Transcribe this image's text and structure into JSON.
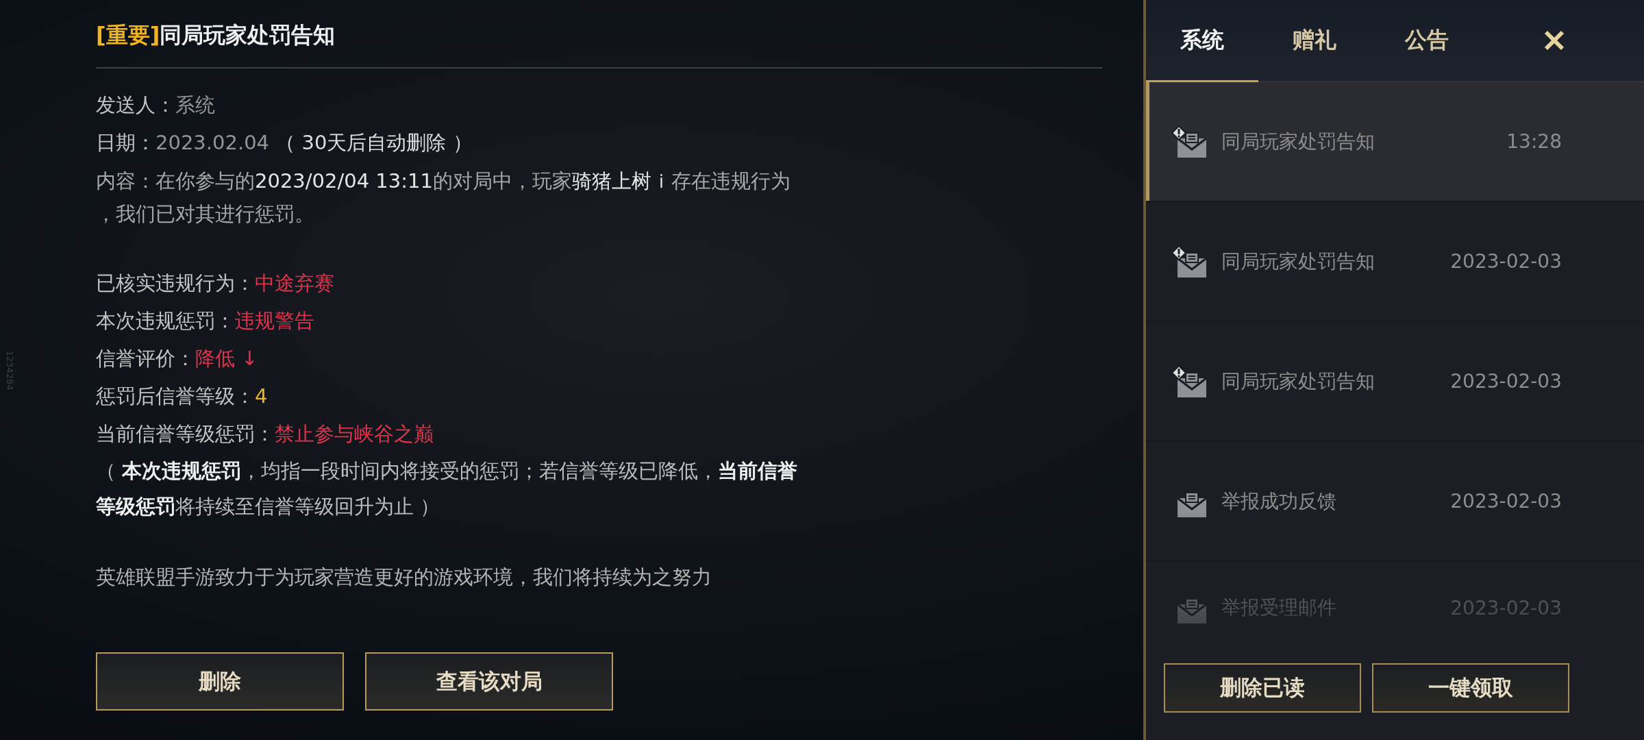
{
  "id_overlay": "1234284",
  "mail": {
    "tag": "[重要]",
    "title": "同局玩家处罚告知",
    "sender": {
      "label": "发送人：",
      "value": "系统"
    },
    "date": {
      "label": "日期：",
      "value": "2023.02.04",
      "note": "（ 30天后自动删除 ）"
    },
    "content": "内容：在你参与的**2023/02/04 13:11**的对局中，玩家**骑猪上树ｉ**存在违规行为，我们已对其进行惩罚。",
    "penalties": [
      {
        "label": "已核实违规行为：",
        "value": "中途弃赛",
        "color": "#e0334c"
      },
      {
        "label": "本次违规惩罚：",
        "value": "违规警告",
        "color": "#e0334c"
      },
      {
        "label": "信誉评价：",
        "value": "降低 ↓",
        "color": "#e0334c"
      },
      {
        "label": "惩罚后信誉等级：",
        "value": "4",
        "color": "#e8b22c"
      },
      {
        "label": "当前信誉等级惩罚：",
        "value": "禁止参与峡谷之巅",
        "color": "#e0334c"
      }
    ],
    "note": "（ **本次违规惩罚**，均指一段时间内将接受的惩罚；若信誉等级已降低，**当前信誉等级惩罚**将持续至信誉等级回升为止 ）",
    "footer": "英雄联盟手游致力于为玩家营造更好的游戏环境，我们将持续为之努力",
    "buttons": [
      "删除",
      "查看该对局"
    ]
  },
  "tabs": [
    {
      "label": "系统",
      "selected": true
    },
    {
      "label": "赠礼",
      "selected": false
    },
    {
      "label": "公告",
      "selected": false
    }
  ],
  "mail_list": [
    {
      "kind": "warning",
      "title": "同局玩家处罚告知",
      "time": "13:28",
      "selected": true
    },
    {
      "kind": "warning",
      "title": "同局玩家处罚告知",
      "time": "2023-02-03",
      "selected": false
    },
    {
      "kind": "warning",
      "title": "同局玩家处罚告知",
      "time": "2023-02-03",
      "selected": false
    },
    {
      "kind": "plain",
      "title": "举报成功反馈",
      "time": "2023-02-03",
      "selected": false
    },
    {
      "kind": "plain",
      "title": "举报受理邮件",
      "time": "2023-02-03",
      "selected": false
    }
  ],
  "list_buttons": [
    "删除已读",
    "一键领取"
  ]
}
